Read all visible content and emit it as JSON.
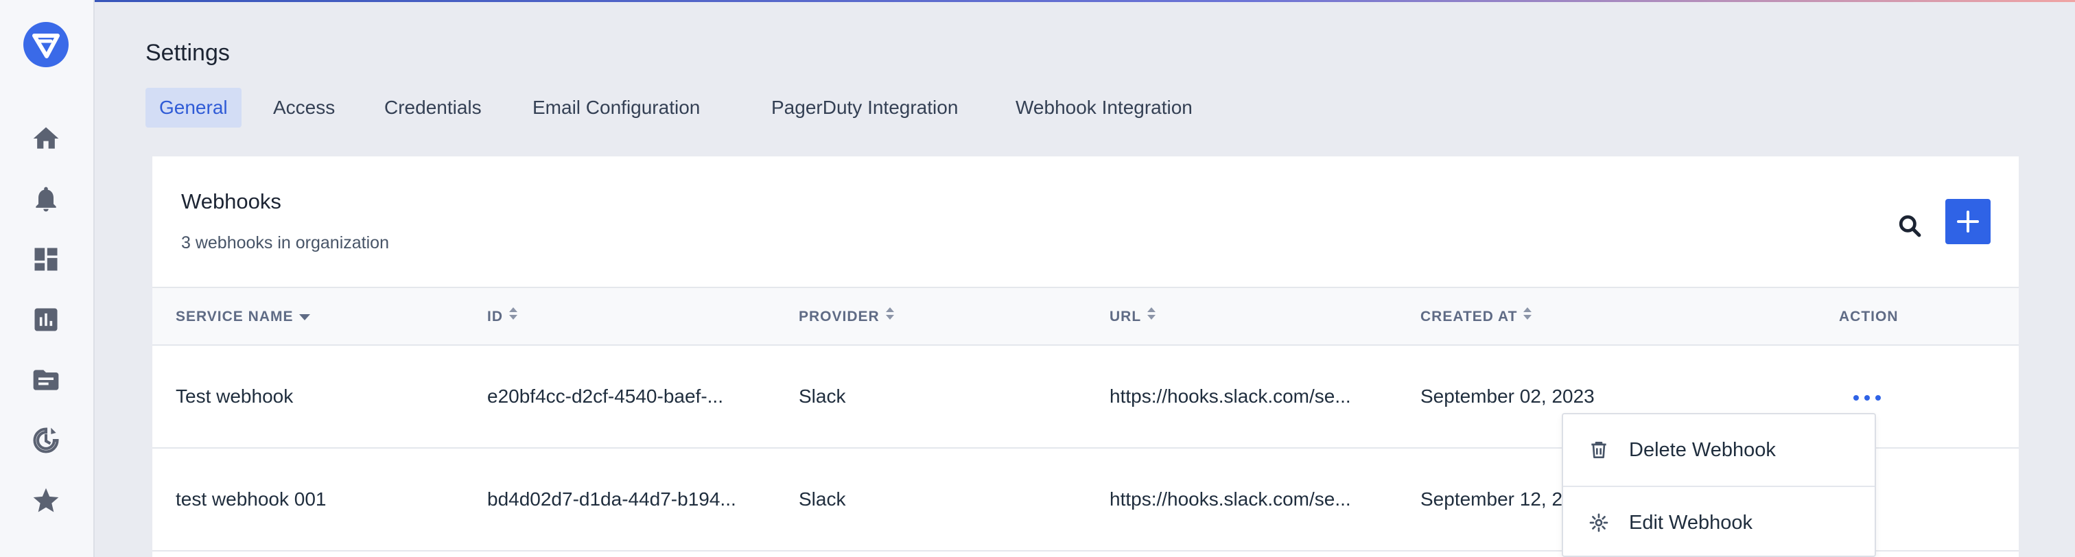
{
  "sidebar": {
    "logo": "logo-icon",
    "items": [
      {
        "icon": "home-icon"
      },
      {
        "icon": "bell-icon"
      },
      {
        "icon": "dashboard-icon"
      },
      {
        "icon": "analytics-icon"
      },
      {
        "icon": "folder-icon"
      },
      {
        "icon": "history-icon"
      },
      {
        "icon": "star-icon"
      }
    ]
  },
  "header": {
    "title": "Settings",
    "tabs": [
      {
        "label": "General",
        "active": true
      },
      {
        "label": "Access"
      },
      {
        "label": "Credentials"
      },
      {
        "label": "Email Configuration"
      },
      {
        "label": "PagerDuty Integration"
      },
      {
        "label": "Webhook Integration"
      }
    ]
  },
  "card": {
    "title": "Webhooks",
    "subtitle": "3 webhooks in organization",
    "search_icon": "search-icon",
    "add_icon": "plus-icon"
  },
  "table": {
    "columns": [
      {
        "label": "SERVICE NAME",
        "sort": "desc"
      },
      {
        "label": "ID",
        "sort": "both"
      },
      {
        "label": "PROVIDER",
        "sort": "both"
      },
      {
        "label": "URL",
        "sort": "both"
      },
      {
        "label": "CREATED AT",
        "sort": "both"
      },
      {
        "label": "ACTION",
        "sort": "none"
      }
    ],
    "rows": [
      {
        "service_name": "Test webhook",
        "id": "e20bf4cc-d2cf-4540-baef-...",
        "provider": "Slack",
        "url": "https://hooks.slack.com/se...",
        "created_at": "September 02, 2023"
      },
      {
        "service_name": "test webhook 001",
        "id": "bd4d02d7-d1da-44d7-b194...",
        "provider": "Slack",
        "url": "https://hooks.slack.com/se...",
        "created_at": "September 12, 2023"
      }
    ]
  },
  "action_menu": {
    "items": [
      {
        "label": "Delete Webhook",
        "icon": "trash-icon"
      },
      {
        "label": "Edit Webhook",
        "icon": "gear-icon"
      }
    ]
  },
  "colors": {
    "accent": "#2f63e6",
    "active_tab_bg": "#d3ddf5",
    "background": "#e9ebf1"
  }
}
